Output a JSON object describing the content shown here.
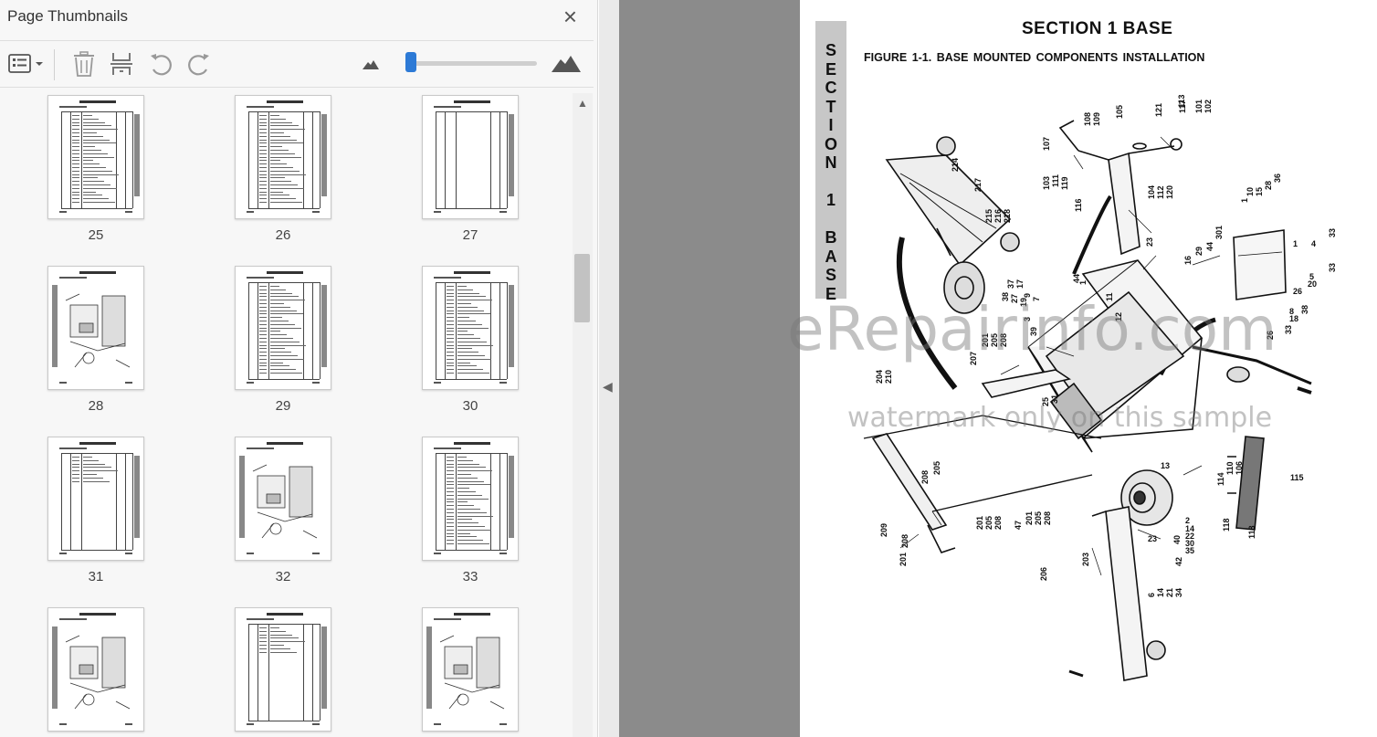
{
  "panel": {
    "title": "Page Thumbnails",
    "close_icon": "×",
    "toolbar": {
      "options_icon": "list-options-icon",
      "delete_icon": "trash-icon",
      "insert_icon": "insert-pages-icon",
      "undo_icon": "undo-icon",
      "redo_icon": "redo-icon",
      "zoom_out_icon": "mountain-small-icon",
      "zoom_in_icon": "mountain-large-icon",
      "thumbnail_size": 0.02
    },
    "thumbnails": [
      {
        "page": "25",
        "kind": "table"
      },
      {
        "page": "26",
        "kind": "table"
      },
      {
        "page": "27",
        "kind": "table-empty"
      },
      {
        "page": "28",
        "kind": "diagram"
      },
      {
        "page": "29",
        "kind": "table"
      },
      {
        "page": "30",
        "kind": "table"
      },
      {
        "page": "31",
        "kind": "table-short"
      },
      {
        "page": "32",
        "kind": "diagram"
      },
      {
        "page": "33",
        "kind": "table"
      },
      {
        "page": "",
        "kind": "diagram"
      },
      {
        "page": "",
        "kind": "table-short"
      },
      {
        "page": "",
        "kind": "diagram"
      }
    ],
    "thumb_line_color": "#444444"
  },
  "document": {
    "section_title": "SECTION 1  BASE",
    "figure_title": "FIGURE 1-1.   BASE MOUNTED COMPONENTS INSTALLATION",
    "side_tab": "SECTION 1 BASE",
    "side_tab_letters": [
      "S",
      "E",
      "C",
      "T",
      "I",
      "O",
      "N",
      "",
      "1",
      "",
      "B",
      "A",
      "S",
      "E"
    ],
    "callouts": [
      {
        "t": "113"
      },
      {
        "t": "121"
      },
      {
        "t": "117"
      },
      {
        "t": "101"
      },
      {
        "t": "102"
      },
      {
        "t": "108"
      },
      {
        "t": "109"
      },
      {
        "t": "105"
      },
      {
        "t": "107"
      },
      {
        "t": "103"
      },
      {
        "t": "111"
      },
      {
        "t": "119"
      },
      {
        "t": "104"
      },
      {
        "t": "112"
      },
      {
        "t": "120"
      },
      {
        "t": "214"
      },
      {
        "t": "217"
      },
      {
        "t": "215"
      },
      {
        "t": "216"
      },
      {
        "t": "218"
      },
      {
        "t": "116"
      },
      {
        "t": "1"
      },
      {
        "t": "10"
      },
      {
        "t": "15"
      },
      {
        "t": "28"
      },
      {
        "t": "36"
      },
      {
        "t": "23"
      },
      {
        "t": "16"
      },
      {
        "t": "29"
      },
      {
        "t": "44"
      },
      {
        "t": "301"
      },
      {
        "t": "1"
      },
      {
        "t": "4"
      },
      {
        "t": "33"
      },
      {
        "t": "5"
      },
      {
        "t": "20"
      },
      {
        "t": "33"
      },
      {
        "t": "26"
      },
      {
        "t": "8"
      },
      {
        "t": "18"
      },
      {
        "t": "38"
      },
      {
        "t": "26"
      },
      {
        "t": "33"
      },
      {
        "t": "44"
      },
      {
        "t": "1"
      },
      {
        "t": "37"
      },
      {
        "t": "17"
      },
      {
        "t": "9"
      },
      {
        "t": "7"
      },
      {
        "t": "38"
      },
      {
        "t": "27"
      },
      {
        "t": "19"
      },
      {
        "t": "3"
      },
      {
        "t": "11"
      },
      {
        "t": "12"
      },
      {
        "t": "39"
      },
      {
        "t": "201"
      },
      {
        "t": "205"
      },
      {
        "t": "208"
      },
      {
        "t": "207"
      },
      {
        "t": "204"
      },
      {
        "t": "210"
      },
      {
        "t": "25"
      },
      {
        "t": "31"
      },
      {
        "t": "13"
      },
      {
        "t": "115"
      },
      {
        "t": "110"
      },
      {
        "t": "106"
      },
      {
        "t": "114"
      },
      {
        "t": "2"
      },
      {
        "t": "14"
      },
      {
        "t": "22"
      },
      {
        "t": "30"
      },
      {
        "t": "35"
      },
      {
        "t": "118"
      },
      {
        "t": "118"
      },
      {
        "t": "208"
      },
      {
        "t": "205"
      },
      {
        "t": "209"
      },
      {
        "t": "208"
      },
      {
        "t": "201"
      },
      {
        "t": "201"
      },
      {
        "t": "205"
      },
      {
        "t": "208"
      },
      {
        "t": "47"
      },
      {
        "t": "201"
      },
      {
        "t": "205"
      },
      {
        "t": "208"
      },
      {
        "t": "23"
      },
      {
        "t": "40"
      },
      {
        "t": "42"
      },
      {
        "t": "206"
      },
      {
        "t": "203"
      },
      {
        "t": "6"
      },
      {
        "t": "14"
      },
      {
        "t": "21"
      },
      {
        "t": "34"
      }
    ],
    "watermark_main": "eRepairinfo.com",
    "watermark_sub": "watermark only on this sample"
  },
  "colors": {
    "accent": "#2d7ad6",
    "doc_background": "#8b8b8b",
    "side_tab": "#c7c7c7"
  },
  "gutter": {
    "collapse_icon": "◀"
  }
}
